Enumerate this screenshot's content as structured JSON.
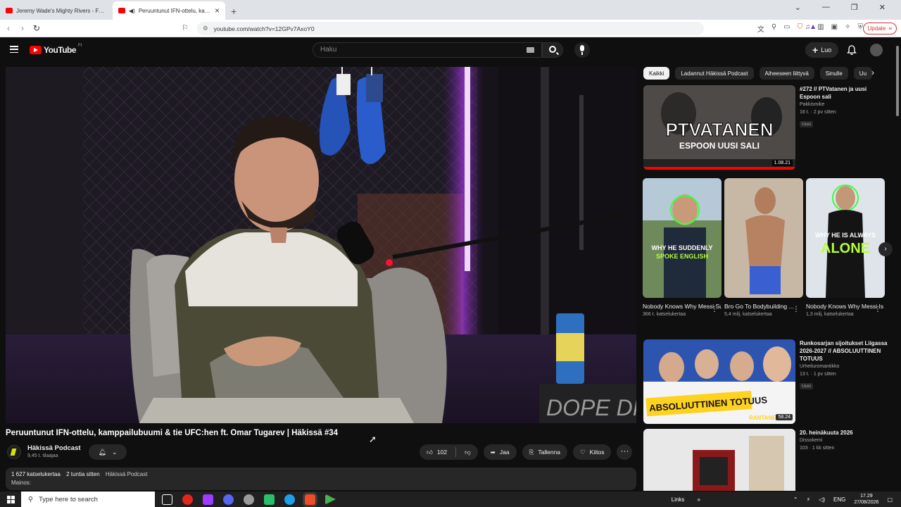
{
  "browser": {
    "tabs": [
      {
        "title": "Jeremy Wade's Mighty Rivers - Full E",
        "active": false
      },
      {
        "title": "Peruuntunut IFN-ottelu, kamp",
        "active": true
      }
    ],
    "url": "youtube.com/watch?v=12GPv7AxoY0",
    "update_label": "Update"
  },
  "youtube": {
    "logo_text": "YouTube",
    "country": "FI",
    "search_placeholder": "Haku",
    "create_label": "Luo"
  },
  "video": {
    "title": "Peruuntunut IFN-ottelu, kamppailubuumi & tie UFC:hen ft. Omar Tugarev | Häkissä #34",
    "channel": "Häkissä Podcast",
    "subscribers": "9,45 t. tilaajaa",
    "likes": "102",
    "share_label": "Jaa",
    "save_label": "Tallenna",
    "thanks_label": "Kiitos",
    "views": "1 627 katselukertaa",
    "age": "2 tuntia sitten",
    "desc_channel": "Häkissä Podcast",
    "desc_line2": "Mainos:",
    "overlay_text": "DOPE DRIN"
  },
  "chips": [
    "Kaikki",
    "Ladannut Häkissä Podcast",
    "Aiheeseen liittyvä",
    "Sinulle",
    "Uu"
  ],
  "recommendations": [
    {
      "title": "#272 // PTVatanen ja uusi Espoon sali",
      "channel": "Pakkismike",
      "meta": "16 t. · 2 pv sitten",
      "badge": "Uusi",
      "duration": "1.08.21",
      "thumb_text_1": "PTVATANEN",
      "thumb_text_2": "ESPOON UUSI SALI"
    },
    {
      "title": "Runkosarjan sijoitukset Liigassa 2026-2027 // ABSOLUUTTINEN TOTUUS",
      "channel": "Urheiluromantikko",
      "meta": "13 t. · 1 pv sitten",
      "badge": "Uusi",
      "duration": "58.24",
      "thumb_text_1": "ABSOLUUTTINEN TOTUUS",
      "thumb_text_2": "RANTANEN"
    },
    {
      "title": "20. heinäkuuta 2026",
      "channel": "Dissokemi",
      "meta": "103 · 1 kk sitten",
      "badge": "",
      "duration": ""
    }
  ],
  "shorts": [
    {
      "title": "Nobody Knows Why Messi Suddenly ...",
      "views": "366 t. katselukertaa",
      "caption_1": "WHY HE SUDDENLY",
      "caption_2": "SPOKE ENGLISH"
    },
    {
      "title": "Bro Go To Bodybuilding ...",
      "views": "5,4 milj. katselukertaa",
      "caption_1": "",
      "caption_2": ""
    },
    {
      "title": "Nobody Knows Why Messi Is Always ...",
      "views": "1,3 milj. katselukertaa",
      "caption_1": "WHY HE IS ALWAYS",
      "caption_2": "ALONE"
    }
  ],
  "taskbar": {
    "search_placeholder": "Type here to search",
    "links_label": "Links",
    "lang": "ENG",
    "time": "17.29",
    "date": "27/08/2026"
  },
  "colors": {
    "accent_red": "#ff0000",
    "yt_bg": "#0f0f0f",
    "chip_bg": "#272727"
  }
}
